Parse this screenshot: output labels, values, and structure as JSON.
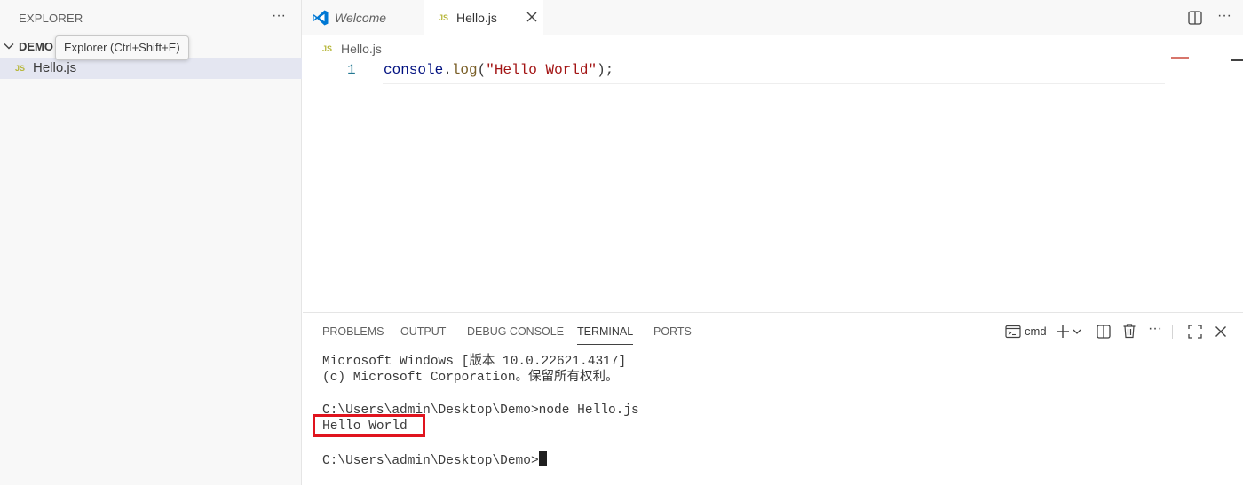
{
  "sidebar": {
    "title": "EXPLORER",
    "more_label": "···",
    "folder": "DEMO",
    "file_badge": "JS",
    "file_name": "Hello.js",
    "tooltip": "Explorer (Ctrl+Shift+E)"
  },
  "tabs": [
    {
      "label": "Welcome",
      "icon": "vscode-icon"
    },
    {
      "label": "Hello.js",
      "badge": "JS",
      "active": true
    }
  ],
  "editor": {
    "more_label": "···",
    "breadcrumb_badge": "JS",
    "breadcrumb": "Hello.js",
    "line_number": "1",
    "code": {
      "object": "console",
      "dot": ".",
      "method": "log",
      "open": "(",
      "string": "\"Hello World\"",
      "close": ");"
    }
  },
  "panel": {
    "tabs": [
      "PROBLEMS",
      "OUTPUT",
      "DEBUG CONSOLE",
      "TERMINAL",
      "PORTS"
    ],
    "active_tab": "TERMINAL",
    "terminal_name": "cmd",
    "more_label": "···",
    "terminal_lines": [
      "Microsoft Windows [版本 10.0.22621.4317]",
      "(c) Microsoft Corporation。保留所有权利。",
      "",
      "C:\\Users\\admin\\Desktop\\Demo>node Hello.js",
      "Hello World",
      "",
      "C:\\Users\\admin\\Desktop\\Demo>"
    ]
  },
  "colors": {
    "accent_highlight": "#e0141e",
    "js_badge": "#b7b73b",
    "vscode_blue": "#0078d4"
  }
}
